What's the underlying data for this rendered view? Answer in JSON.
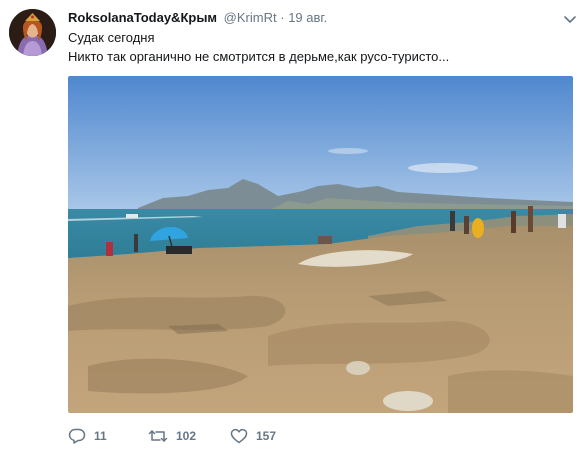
{
  "tweet": {
    "author_name": "RoksolanaToday&Крым",
    "author_handle": "@KrimRt",
    "separator": "·",
    "date": "19 авг.",
    "text_line1": "Судак сегодня",
    "text_line2": "Никто так органично не смотрится в дерьме,как русо-туристо..."
  },
  "actions": {
    "reply_count": "11",
    "retweet_count": "102",
    "like_count": "157"
  },
  "icons": {
    "avatar": "avatar-portrait",
    "menu": "chevron-down-icon",
    "reply": "reply-icon",
    "retweet": "retweet-icon",
    "like": "heart-icon"
  },
  "colors": {
    "text": "#14171a",
    "secondary": "#657786",
    "sky": "#5b93d4",
    "sea": "#3c8fa5",
    "rock": "#b79a72"
  }
}
